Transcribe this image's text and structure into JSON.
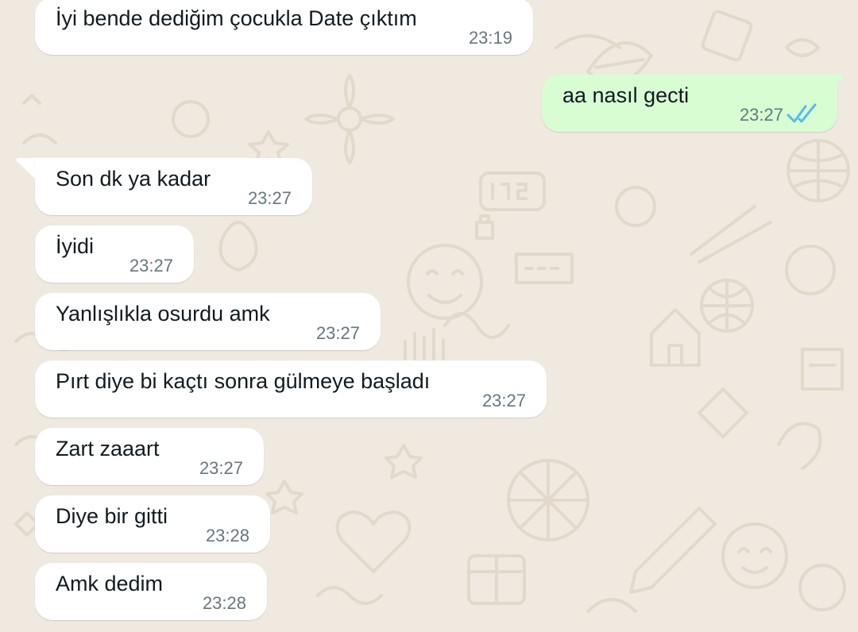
{
  "messages": [
    {
      "direction": "in",
      "text": "İyi bende dediğim çocukla Date çıktım",
      "time": "23:19"
    },
    {
      "direction": "out",
      "text": "aa nasıl gecti",
      "time": "23:27",
      "status": "read",
      "status_icon": "double-check-icon",
      "status_color": "#53bdeb"
    },
    {
      "direction": "in",
      "text": "Son dk ya kadar",
      "time": "23:27"
    },
    {
      "direction": "in",
      "text": "İyidi",
      "time": "23:27"
    },
    {
      "direction": "in",
      "text": "Yanlışlıkla osurdu amk",
      "time": "23:27"
    },
    {
      "direction": "in",
      "text": "Pırt diye bi kaçtı sonra gülmeye başladı",
      "time": "23:27"
    },
    {
      "direction": "in",
      "text": "Zart zaaart",
      "time": "23:27"
    },
    {
      "direction": "in",
      "text": "Diye bir gitti",
      "time": "23:28"
    },
    {
      "direction": "in",
      "text": "Amk dedim",
      "time": "23:28"
    }
  ],
  "colors": {
    "wallpaper": "#efe9e0",
    "doodle": "#e2d9cb",
    "incoming_bubble": "#ffffff",
    "outgoing_bubble": "#d9fdd3",
    "message_text": "#111b21",
    "timestamp": "#667781",
    "read_ticks": "#53bdeb"
  }
}
